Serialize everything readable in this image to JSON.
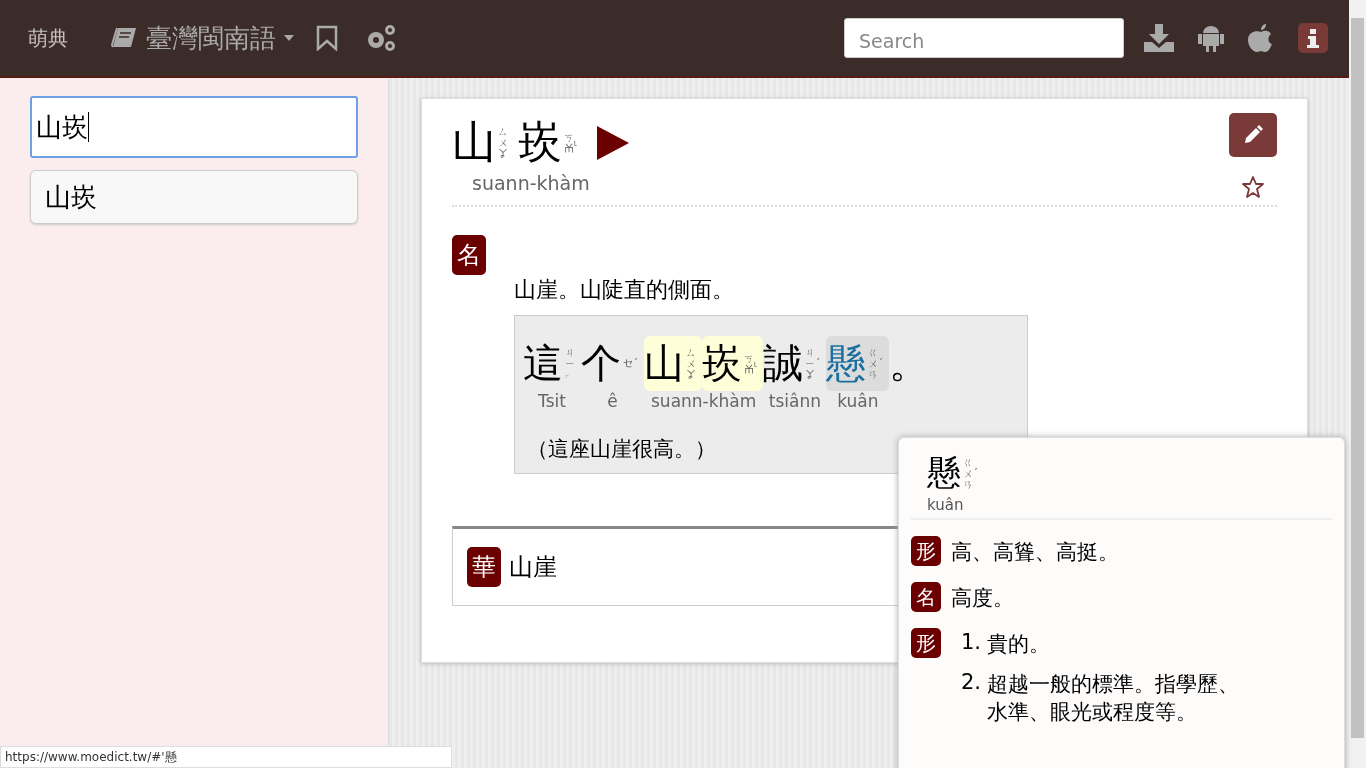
{
  "header": {
    "logo": "萌典",
    "dictionary": "臺灣閩南語",
    "search": {
      "placeholder": "Search"
    }
  },
  "sidebar": {
    "query": "山崁",
    "suggestions": [
      {
        "text": "山崁"
      }
    ]
  },
  "entry": {
    "title": [
      {
        "char": "山",
        "zhuyin": "ㄙㄨㆩ"
      },
      {
        "char": "崁",
        "zhuyin": "ㄎㆰ",
        "tone": "˪"
      }
    ],
    "romanization": "suann-khàm",
    "definitions": [
      {
        "pos": "名",
        "text": "山崖。山陡直的側面。",
        "example": {
          "groups": [
            {
              "kind": "plain",
              "roman": "Tsit",
              "chars": [
                {
                  "char": "這",
                  "zhuyin": "ㄐㄧㆷ"
                }
              ]
            },
            {
              "kind": "plain",
              "roman": "ê",
              "chars": [
                {
                  "char": "个",
                  "zhuyin": "ㆤ",
                  "tone": "ˊ"
                }
              ]
            },
            {
              "kind": "headword",
              "roman": "suann-khàm",
              "chars": [
                {
                  "char": "山",
                  "zhuyin": "ㄙㄨㆩ"
                },
                {
                  "char": "崁",
                  "zhuyin": "ㄎㆰ",
                  "tone": "˪"
                }
              ]
            },
            {
              "kind": "plain",
              "roman": "tsiânn",
              "chars": [
                {
                  "char": "誠",
                  "zhuyin": "ㄐㄧㆩ",
                  "tone": "ˊ"
                }
              ]
            },
            {
              "kind": "hover",
              "roman": "kuân",
              "chars": [
                {
                  "char": "懸",
                  "zhuyin": "ㄍㄨㄢ",
                  "tone": "ˊ"
                }
              ]
            },
            {
              "kind": "punct",
              "chars": [
                {
                  "char": "。"
                }
              ]
            }
          ],
          "translation": "（這座山崖很高。）"
        }
      }
    ],
    "mandarin": {
      "label": "華",
      "text": "山崖"
    }
  },
  "popup": {
    "char": "懸",
    "zhuyin": "ㄍㄨㄢ",
    "tone": "ˊ",
    "romanization": "kuân",
    "definitions": [
      {
        "pos": "形",
        "items": [
          {
            "text": "高、高聳、高挺。"
          }
        ]
      },
      {
        "pos": "名",
        "items": [
          {
            "text": "高度。"
          }
        ]
      },
      {
        "pos": "形",
        "items": [
          {
            "num": "1.",
            "text": "貴的。"
          },
          {
            "num": "2.",
            "text": "超越一般的標準。指學歷、水準、眼光或程度等。"
          }
        ]
      }
    ]
  },
  "status_url": "https://www.moedict.tw/#'懸"
}
